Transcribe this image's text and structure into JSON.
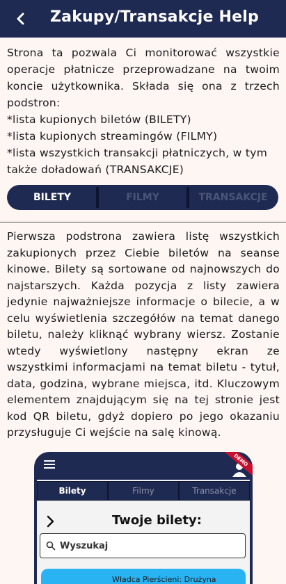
{
  "appbar": {
    "title": "Zakupy/Transakcje Help"
  },
  "intro": {
    "paragraph": "Strona ta pozwala Ci monitorować wszystkie operacje płatnicze przeprowadzane na twoim koncie użytkownika. Składa się ona z trzech podstron:",
    "items": [
      " *lista kupionych biletów (BILETY)",
      " *lista kupionych streamingów (FILMY)",
      " *lista wszystkich transakcji płatniczych, w tym także doładowań (TRANSAKCJE)"
    ]
  },
  "segmented": {
    "tabs": [
      "BILETY",
      "FILMY",
      "TRANSAKCJE"
    ],
    "active": "BILETY"
  },
  "section2": {
    "paragraph": "Pierwsza podstrona zawiera listę wszystkich zakupionych przez Ciebie biletów na seanse kinowe. Bilety są sortowane od najnowszych do najstarszych. Każda pozycja z listy zawiera jedynie najważniejsze informacje o bilecie, a w celu wyświetlenia szczegółów na temat danego biletu, należy kliknąć wybrany wiersz. Zostanie wtedy wyświetlony następny ekran ze wszystkimi informacjami na temat biletu - tytuł, data, godzina, wybrane miejsca, itd. Kluczowym elementem znajdującym się na tej stronie jest kod QR biletu, gdyż dopiero po jego okazaniu przysługuje Ci wejście na salę kinową."
  },
  "preview": {
    "badge": "DEMO",
    "tabs": [
      "Bilety",
      "Filmy",
      "Transakcje"
    ],
    "active": "Bilety",
    "title": "Twoje bilety:",
    "search_placeholder": "Wyszukaj",
    "card_text": "Władca Pierścieni: Drużyna"
  },
  "colors": {
    "navy": "#1f2a52",
    "background": "#fdf6f3",
    "card": "#2ab3f2",
    "badge": "#c8102e"
  }
}
